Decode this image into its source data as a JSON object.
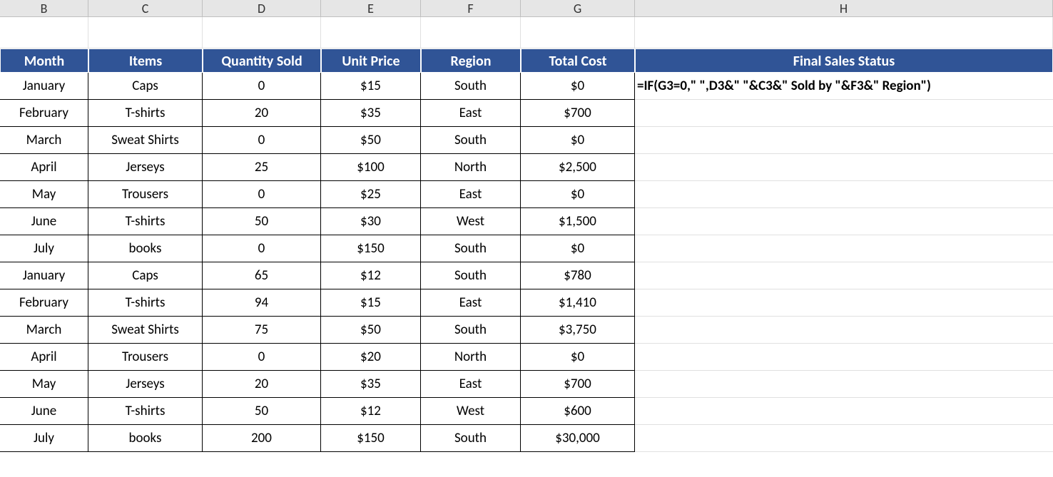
{
  "columns": [
    "B",
    "C",
    "D",
    "E",
    "F",
    "G",
    "H"
  ],
  "headers": {
    "month": "Month",
    "items": "Items",
    "quantity": "Quantity Sold",
    "unitPrice": "Unit Price",
    "region": "Region",
    "totalCost": "Total Cost",
    "status": "Final Sales Status"
  },
  "formula": "=IF(G3=0,\" \",D3&\" \"&C3&\" Sold by \"&F3&\" Region\")",
  "rows": [
    {
      "month": "January",
      "items": "Caps",
      "quantity": "0",
      "unitPrice": "$15",
      "region": "South",
      "totalCost": "$0"
    },
    {
      "month": "February",
      "items": "T-shirts",
      "quantity": "20",
      "unitPrice": "$35",
      "region": "East",
      "totalCost": "$700"
    },
    {
      "month": "March",
      "items": "Sweat Shirts",
      "quantity": "0",
      "unitPrice": "$50",
      "region": "South",
      "totalCost": "$0"
    },
    {
      "month": "April",
      "items": "Jerseys",
      "quantity": "25",
      "unitPrice": "$100",
      "region": "North",
      "totalCost": "$2,500"
    },
    {
      "month": "May",
      "items": "Trousers",
      "quantity": "0",
      "unitPrice": "$25",
      "region": "East",
      "totalCost": "$0"
    },
    {
      "month": "June",
      "items": "T-shirts",
      "quantity": "50",
      "unitPrice": "$30",
      "region": "West",
      "totalCost": "$1,500"
    },
    {
      "month": "July",
      "items": "books",
      "quantity": "0",
      "unitPrice": "$150",
      "region": "South",
      "totalCost": "$0"
    },
    {
      "month": "January",
      "items": "Caps",
      "quantity": "65",
      "unitPrice": "$12",
      "region": "South",
      "totalCost": "$780"
    },
    {
      "month": "February",
      "items": "T-shirts",
      "quantity": "94",
      "unitPrice": "$15",
      "region": "East",
      "totalCost": "$1,410"
    },
    {
      "month": "March",
      "items": "Sweat Shirts",
      "quantity": "75",
      "unitPrice": "$50",
      "region": "South",
      "totalCost": "$3,750"
    },
    {
      "month": "April",
      "items": "Trousers",
      "quantity": "0",
      "unitPrice": "$20",
      "region": "North",
      "totalCost": "$0"
    },
    {
      "month": "May",
      "items": "Jerseys",
      "quantity": "20",
      "unitPrice": "$35",
      "region": "East",
      "totalCost": "$700"
    },
    {
      "month": "June",
      "items": "T-shirts",
      "quantity": "50",
      "unitPrice": "$12",
      "region": "West",
      "totalCost": "$600"
    },
    {
      "month": "July",
      "items": "books",
      "quantity": "200",
      "unitPrice": "$150",
      "region": "South",
      "totalCost": "$30,000"
    }
  ]
}
